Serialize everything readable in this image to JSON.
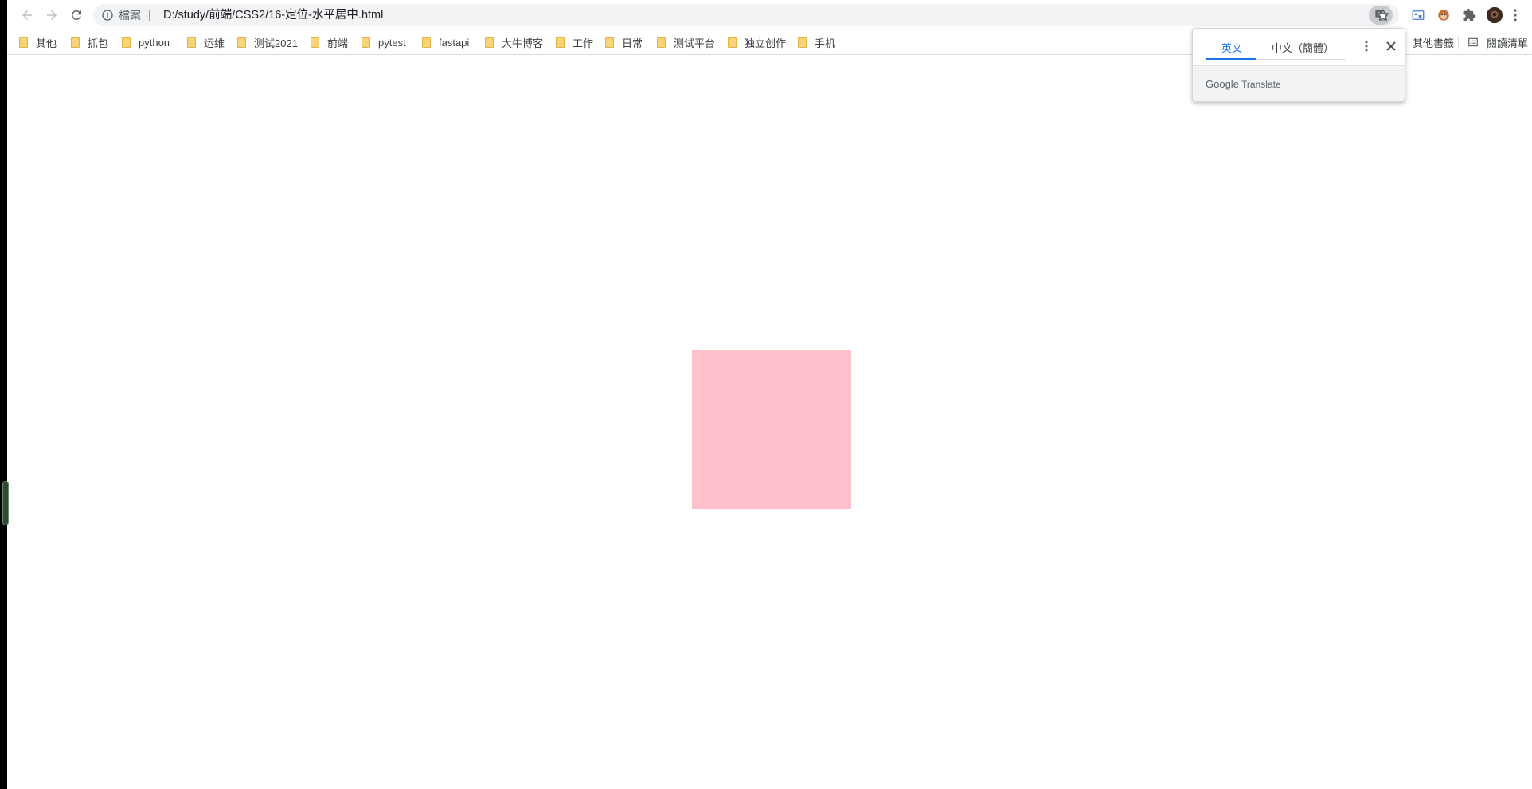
{
  "browser": {
    "site_label": "檔案",
    "url": "D:/study/前端/CSS2/16-定位-水平居中.html"
  },
  "bookmarks": [
    {
      "label": "其他"
    },
    {
      "label": "抓包"
    },
    {
      "label": "python"
    },
    {
      "label": "运维"
    },
    {
      "label": "测试2021"
    },
    {
      "label": "前端"
    },
    {
      "label": "pytest"
    },
    {
      "label": "fastapi"
    },
    {
      "label": "大牛博客"
    },
    {
      "label": "工作"
    },
    {
      "label": "日常"
    },
    {
      "label": "测试平台"
    },
    {
      "label": "独立创作"
    },
    {
      "label": "手机"
    }
  ],
  "bookmarks_right": {
    "other": "其他書籤",
    "reading_list": "閱讀清單"
  },
  "translate_popup": {
    "tab_source": "英文",
    "tab_target": "中文（簡體）",
    "brand_google": "Google",
    "brand_translate": "Translate"
  },
  "page": {
    "box_color": "#ffc0cb"
  },
  "colors": {
    "accent": "#1a73e8",
    "folder": "#f6d57a"
  }
}
